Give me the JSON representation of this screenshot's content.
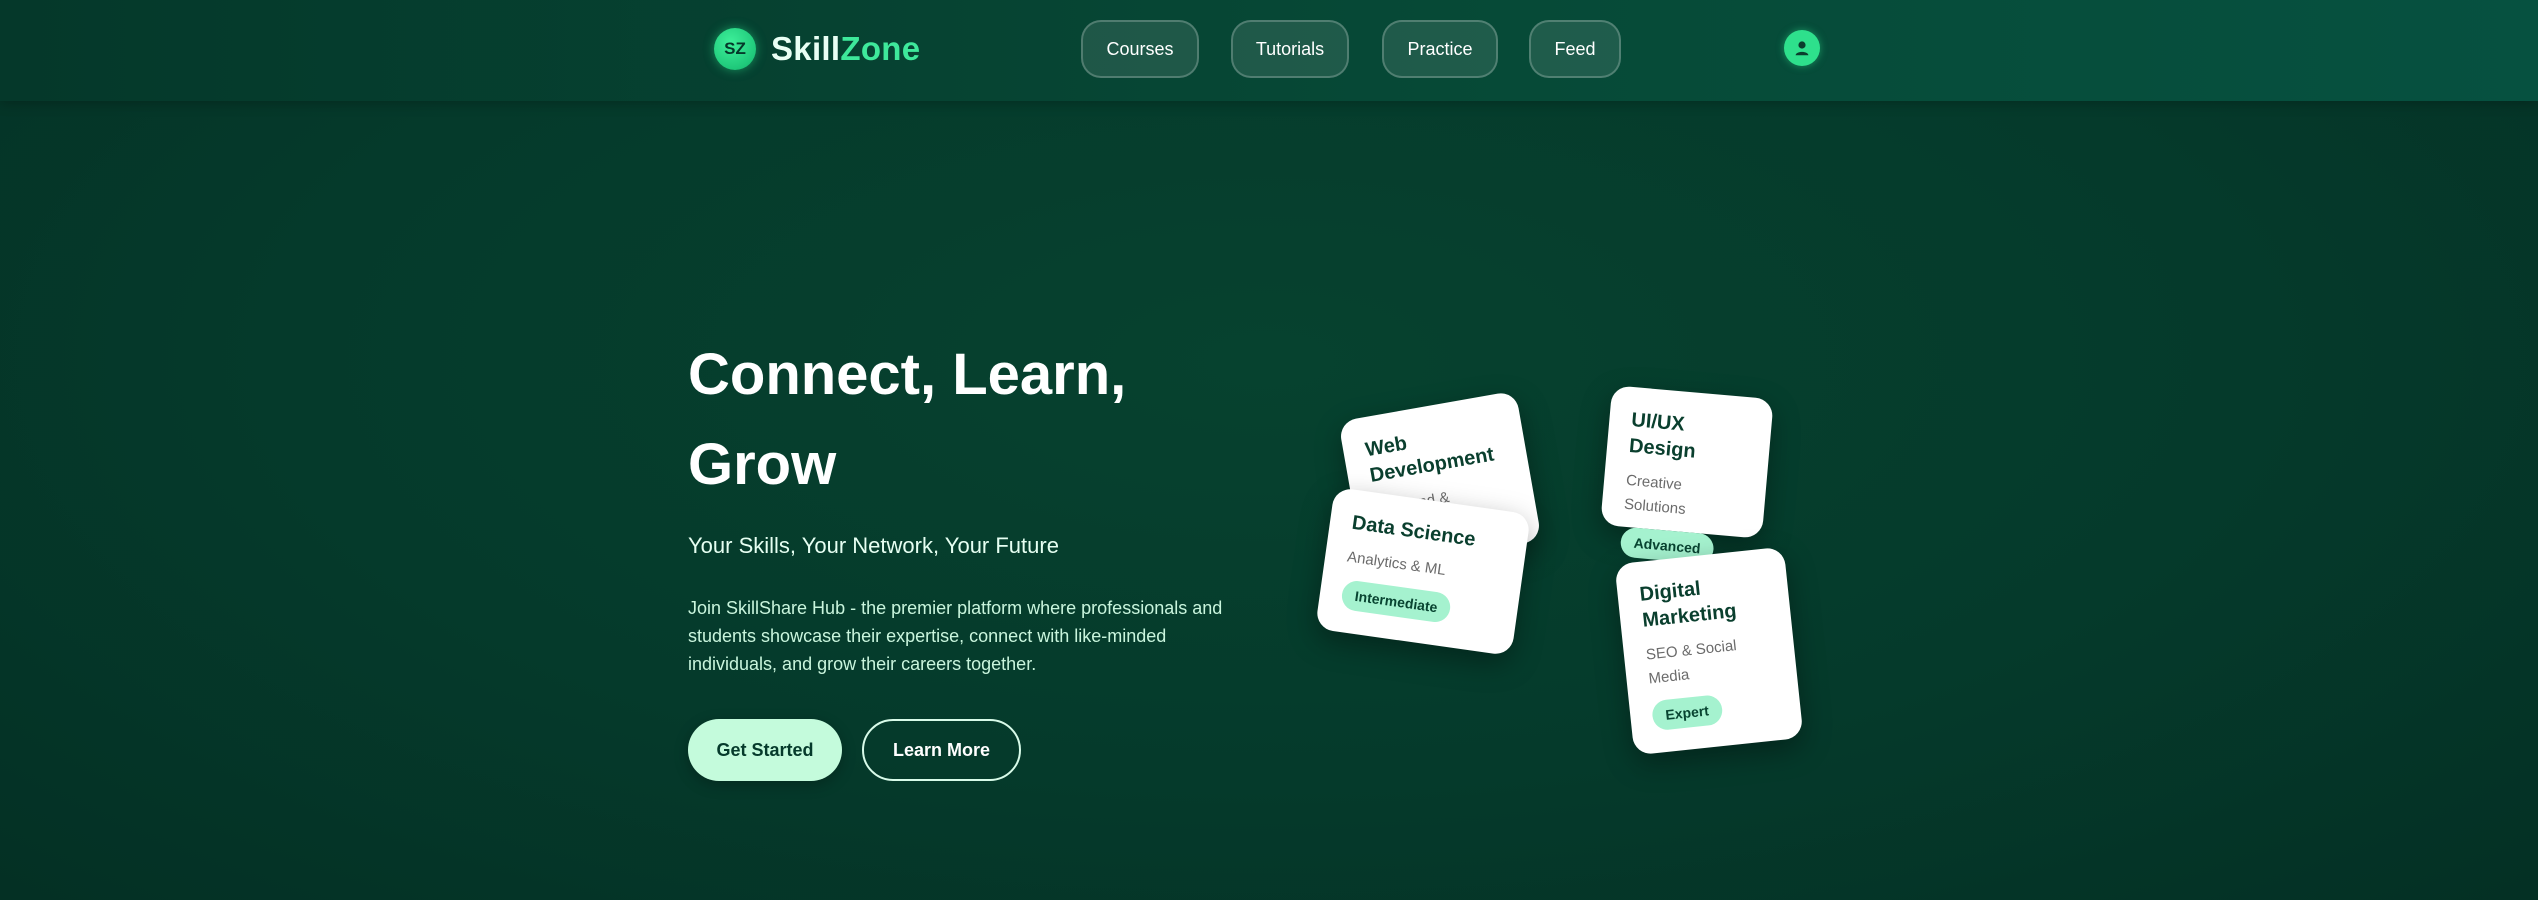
{
  "header": {
    "logo_mark": "SZ",
    "logo_text_part1": "Skill",
    "logo_text_part2": "Zone",
    "nav": [
      {
        "label": "Courses"
      },
      {
        "label": "Tutorials"
      },
      {
        "label": "Practice"
      },
      {
        "label": "Feed"
      }
    ],
    "avatar_icon": "user-icon"
  },
  "hero": {
    "title_line1": "Connect, Learn,",
    "title_line2": "Grow",
    "subtitle": "Your Skills, Your Network, Your Future",
    "description": "Join SkillShare Hub - the premier platform where professionals and students showcase their expertise, connect with like-minded individuals, and grow their careers together.",
    "primary_button": "Get Started",
    "secondary_button": "Learn More"
  },
  "cards": [
    {
      "title": "Web Development",
      "subtitle": "Frontend & Backend"
    },
    {
      "title": "Data Science",
      "subtitle": "Analytics & ML",
      "badge": "Intermediate"
    },
    {
      "title": "UI/UX Design",
      "subtitle": "Creative Solutions",
      "badge": "Advanced"
    },
    {
      "title": "Digital Marketing",
      "subtitle": "SEO & Social Media",
      "badge": "Expert"
    }
  ],
  "colors": {
    "background": "#053a2b",
    "accent": "#2ee08c",
    "badge": "#a5f2cf",
    "primary_button": "#c4fbdc"
  }
}
